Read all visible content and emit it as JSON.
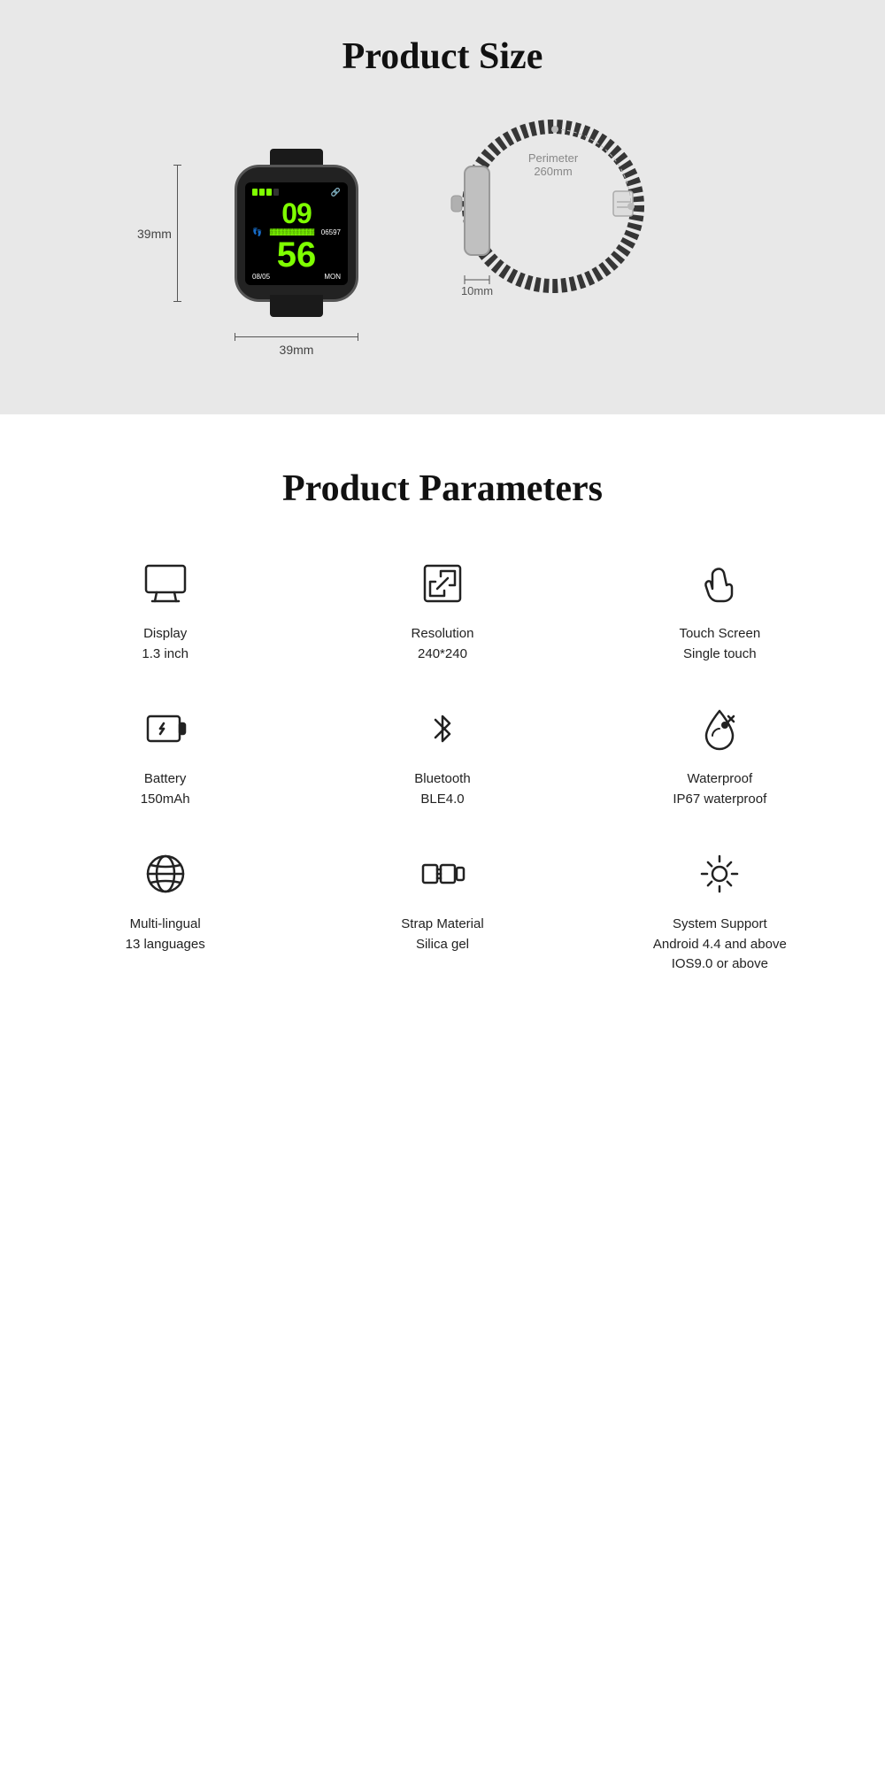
{
  "productSize": {
    "title": "Product Size",
    "frontWatch": {
      "heightLabel": "39mm",
      "widthLabel": "39mm",
      "screenTime": "09",
      "screenMinutes": "56",
      "screenDate": "08/05",
      "screenDay": "MON",
      "screenSteps": "06597"
    },
    "sideWatch": {
      "perimeterLabel": "Perimeter",
      "perimeterValue": "260mm",
      "thicknessValue": "10mm"
    }
  },
  "productParams": {
    "title": "Product Parameters",
    "items": [
      {
        "id": "display",
        "iconName": "display-icon",
        "label": "Display",
        "value": "1.3 inch"
      },
      {
        "id": "resolution",
        "iconName": "resolution-icon",
        "label": "Resolution",
        "value": "240*240"
      },
      {
        "id": "touchscreen",
        "iconName": "touch-screen-icon",
        "label": "Touch Screen",
        "value": "Single touch"
      },
      {
        "id": "battery",
        "iconName": "battery-icon",
        "label": "Battery",
        "value": "150mAh"
      },
      {
        "id": "bluetooth",
        "iconName": "bluetooth-icon",
        "label": "Bluetooth",
        "value": "BLE4.0"
      },
      {
        "id": "waterproof",
        "iconName": "waterproof-icon",
        "label": "Waterproof",
        "value": "IP67 waterproof"
      },
      {
        "id": "multilingual",
        "iconName": "language-icon",
        "label": "Multi-lingual",
        "value": "13 languages"
      },
      {
        "id": "strap",
        "iconName": "strap-icon",
        "label": "Strap Material",
        "value": "Silica gel"
      },
      {
        "id": "system",
        "iconName": "system-icon",
        "label": "System Support",
        "value": "Android 4.4 and above\nIOS9.0 or above"
      }
    ]
  }
}
